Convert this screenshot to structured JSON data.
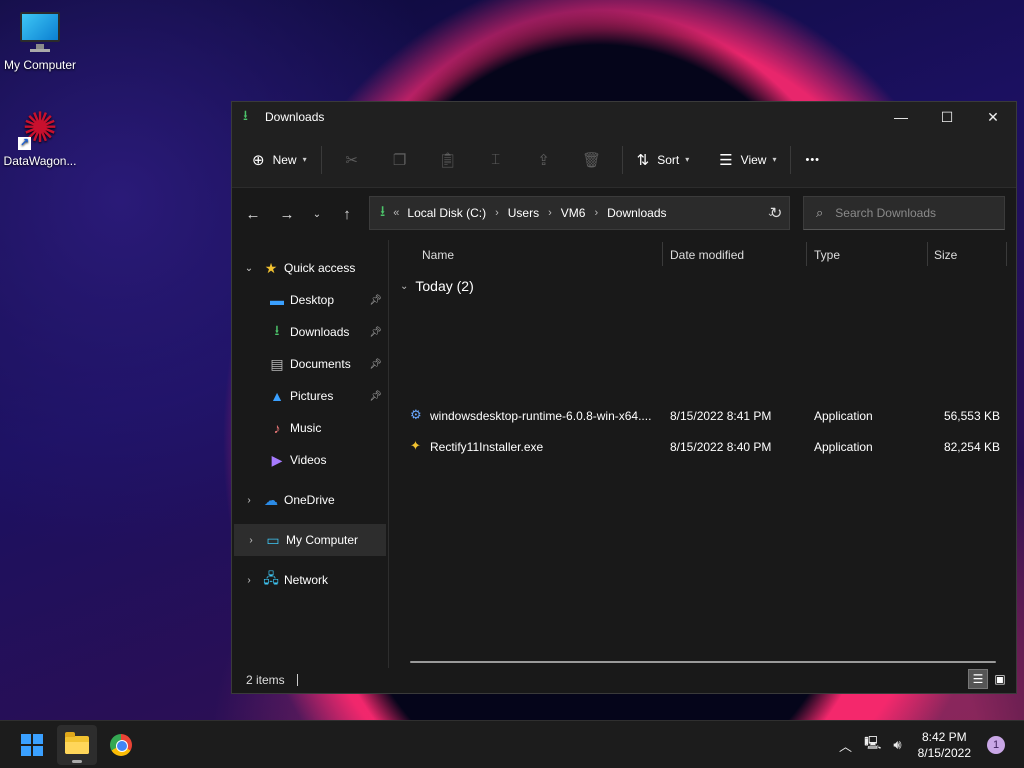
{
  "desktop": {
    "icons": [
      {
        "label": "My Computer"
      },
      {
        "label": "DataWagon..."
      }
    ]
  },
  "window": {
    "title": "Downloads",
    "controls": {
      "minimize": "—",
      "maximize": "☐",
      "close": "✕"
    }
  },
  "toolbar": {
    "new_label": "New",
    "sort_label": "Sort",
    "view_label": "View",
    "more_label": "•••"
  },
  "address": {
    "prefix": "«",
    "crumbs": [
      "Local Disk (C:)",
      "Users",
      "VM6",
      "Downloads"
    ]
  },
  "search": {
    "placeholder": "Search Downloads"
  },
  "sidebar": {
    "items": [
      {
        "label": "Quick access"
      },
      {
        "label": "Desktop"
      },
      {
        "label": "Downloads"
      },
      {
        "label": "Documents"
      },
      {
        "label": "Pictures"
      },
      {
        "label": "Music"
      },
      {
        "label": "Videos"
      },
      {
        "label": "OneDrive"
      },
      {
        "label": "My Computer"
      },
      {
        "label": "Network"
      }
    ]
  },
  "columns": {
    "name": "Name",
    "date": "Date modified",
    "type": "Type",
    "size": "Size"
  },
  "group": {
    "label": "Today (2)"
  },
  "files": [
    {
      "name": "windowsdesktop-runtime-6.0.8-win-x64....",
      "date": "8/15/2022 8:41 PM",
      "type": "Application",
      "size": "56,553 KB"
    },
    {
      "name": "Rectify11Installer.exe",
      "date": "8/15/2022 8:40 PM",
      "type": "Application",
      "size": "82,254 KB"
    }
  ],
  "status": {
    "count": "2 items"
  },
  "taskbar": {
    "time": "8:42 PM",
    "date": "8/15/2022",
    "notification_count": "1"
  },
  "colors": {
    "accent": "#4cc46a",
    "window_bg": "#191919",
    "taskbar_bg": "#1c1c1c"
  }
}
